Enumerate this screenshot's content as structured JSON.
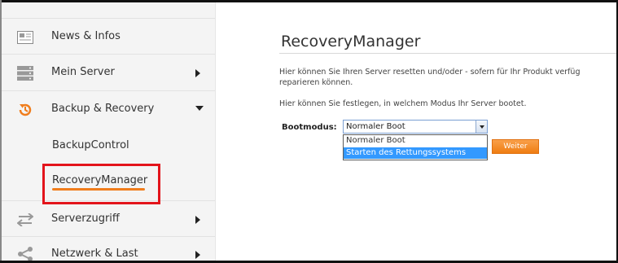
{
  "sidebar": {
    "items": [
      {
        "label": "News & Infos",
        "icon": "newspaper-icon"
      },
      {
        "label": "Mein Server",
        "icon": "server-icon"
      },
      {
        "label": "Backup & Recovery",
        "icon": "backup-restore-icon"
      },
      {
        "label": "Serverzugriff",
        "icon": "transfer-arrows-icon"
      },
      {
        "label": "Netzwerk & Last",
        "icon": "network-share-icon"
      }
    ],
    "sub_items": [
      {
        "label": "BackupControl"
      },
      {
        "label": "RecoveryManager"
      }
    ]
  },
  "main": {
    "title": "RecoveryManager",
    "para1_line1": "Hier können Sie Ihren Server resetten und/oder - sofern für Ihr Produkt verfüg",
    "para1_line2": "reparieren können.",
    "para2": "Hier können Sie festlegen, in welchem Modus Ihr Server bootet.",
    "boot_label": "Bootmodus:",
    "select_value": "Normaler Boot",
    "options": [
      "Normaler Boot",
      "Starten des Rettungssystems"
    ],
    "button_label": "Weiter"
  },
  "colors": {
    "accent_orange": "#f07d1c",
    "highlight_red": "#e3141b",
    "selection_blue": "#3399ff"
  }
}
